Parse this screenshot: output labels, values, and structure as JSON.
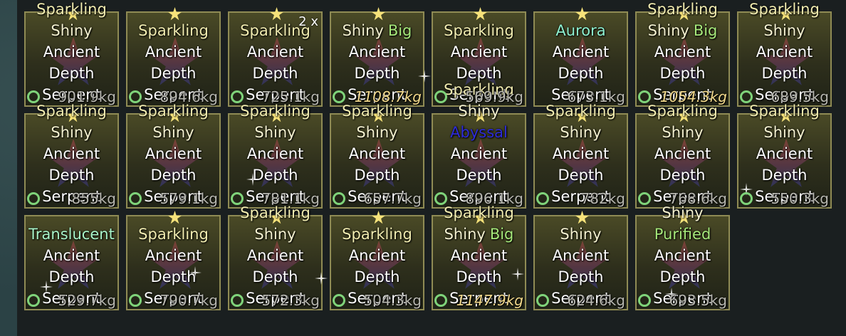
{
  "inventory": {
    "items": [
      {
        "lines": [
          [
            {
              "t": "Sparkling",
              "c": "sparkling"
            }
          ],
          [
            {
              "t": "Shiny",
              "c": "shiny"
            }
          ],
          [
            {
              "t": "Ancient"
            }
          ],
          [
            {
              "t": "Depth"
            }
          ],
          [
            {
              "t": "Serpent"
            }
          ]
        ],
        "weight": "901.9kg",
        "gold": false,
        "star": true
      },
      {
        "lines": [
          [
            {
              "t": "Sparkling",
              "c": "sparkling"
            }
          ],
          [
            {
              "t": "Ancient"
            }
          ],
          [
            {
              "t": "Depth"
            }
          ],
          [
            {
              "t": "Serpent"
            }
          ]
        ],
        "weight": "894.6kg",
        "gold": false,
        "star": true
      },
      {
        "lines": [
          [
            {
              "t": "Sparkling",
              "c": "sparkling"
            }
          ],
          [
            {
              "t": "Ancient"
            }
          ],
          [
            {
              "t": "Depth"
            }
          ],
          [
            {
              "t": "Serpent"
            }
          ]
        ],
        "weight": "725.1kg",
        "gold": false,
        "star": true,
        "count": "2 x"
      },
      {
        "lines": [
          [
            {
              "t": "Shiny",
              "c": "shiny"
            },
            {
              "t": "Big",
              "c": "big"
            }
          ],
          [
            {
              "t": "Ancient"
            }
          ],
          [
            {
              "t": "Depth"
            }
          ],
          [
            {
              "t": "Serpent"
            }
          ]
        ],
        "weight": "1108.7kg",
        "gold": true,
        "star": true
      },
      {
        "lines": [
          [
            {
              "t": "Sparkling",
              "c": "sparkling"
            }
          ],
          [
            {
              "t": "Ancient"
            }
          ],
          [
            {
              "t": "Depth"
            }
          ],
          [
            {
              "t": "Serpent"
            }
          ]
        ],
        "weight": "569.9kg",
        "gold": false,
        "star": true
      },
      {
        "lines": [
          [
            {
              "t": "Aurora",
              "c": "aurora"
            }
          ],
          [
            {
              "t": "Ancient"
            }
          ],
          [
            {
              "t": "Depth"
            }
          ],
          [
            {
              "t": "Serpent"
            }
          ]
        ],
        "weight": "673.1kg",
        "gold": false,
        "star": true,
        "nofav": true
      },
      {
        "lines": [
          [
            {
              "t": "Sparkling",
              "c": "sparkling"
            }
          ],
          [
            {
              "t": "Shiny",
              "c": "shiny"
            },
            {
              "t": "Big",
              "c": "big"
            }
          ],
          [
            {
              "t": "Ancient"
            }
          ],
          [
            {
              "t": "Depth"
            }
          ],
          [
            {
              "t": "Serpent"
            }
          ]
        ],
        "weight": "1054.3kg",
        "gold": true,
        "star": true
      },
      {
        "lines": [
          [
            {
              "t": "Sparkling",
              "c": "sparkling"
            }
          ],
          [
            {
              "t": "Shiny",
              "c": "shiny"
            }
          ],
          [
            {
              "t": "Ancient"
            }
          ],
          [
            {
              "t": "Depth"
            }
          ],
          [
            {
              "t": "Serpent"
            }
          ]
        ],
        "weight": "689.5kg",
        "gold": false,
        "star": true
      },
      {
        "lines": [
          [
            {
              "t": "Sparkling",
              "c": "sparkling"
            }
          ],
          [
            {
              "t": "Shiny",
              "c": "shiny"
            }
          ],
          [
            {
              "t": "Ancient"
            }
          ],
          [
            {
              "t": "Depth"
            }
          ],
          [
            {
              "t": "Serpent"
            }
          ]
        ],
        "weight": "855kg",
        "gold": false,
        "star": true
      },
      {
        "lines": [
          [
            {
              "t": "Sparkling",
              "c": "sparkling"
            }
          ],
          [
            {
              "t": "Shiny",
              "c": "shiny"
            }
          ],
          [
            {
              "t": "Ancient"
            }
          ],
          [
            {
              "t": "Depth"
            }
          ],
          [
            {
              "t": "Serpent"
            }
          ]
        ],
        "weight": "579.1kg",
        "gold": false,
        "star": true
      },
      {
        "lines": [
          [
            {
              "t": "Sparkling",
              "c": "sparkling"
            }
          ],
          [
            {
              "t": "Shiny",
              "c": "shiny"
            }
          ],
          [
            {
              "t": "Ancient"
            }
          ],
          [
            {
              "t": "Depth"
            }
          ],
          [
            {
              "t": "Serpent"
            }
          ]
        ],
        "weight": "781.1kg",
        "gold": false,
        "star": true
      },
      {
        "lines": [
          [
            {
              "t": "Sparkling",
              "c": "sparkling"
            }
          ],
          [
            {
              "t": "Shiny",
              "c": "shiny"
            }
          ],
          [
            {
              "t": "Ancient"
            }
          ],
          [
            {
              "t": "Depth"
            }
          ],
          [
            {
              "t": "Serpent"
            }
          ]
        ],
        "weight": "657.7kg",
        "gold": false,
        "star": true
      },
      {
        "lines": [
          [
            {
              "t": "Sparkling",
              "c": "sparkling"
            }
          ],
          [
            {
              "t": "Shiny",
              "c": "shiny"
            }
          ],
          [
            {
              "t": "Abyssal",
              "c": "abyssal"
            }
          ],
          [
            {
              "t": "Ancient"
            }
          ],
          [
            {
              "t": "Depth"
            }
          ],
          [
            {
              "t": "Serpent"
            }
          ]
        ],
        "weight": "896.1kg",
        "gold": false,
        "star": true
      },
      {
        "lines": [
          [
            {
              "t": "Sparkling",
              "c": "sparkling"
            }
          ],
          [
            {
              "t": "Shiny",
              "c": "shiny"
            }
          ],
          [
            {
              "t": "Ancient"
            }
          ],
          [
            {
              "t": "Depth"
            }
          ],
          [
            {
              "t": "Serpent"
            }
          ]
        ],
        "weight": "782kg",
        "gold": false,
        "star": true
      },
      {
        "lines": [
          [
            {
              "t": "Sparkling",
              "c": "sparkling"
            }
          ],
          [
            {
              "t": "Shiny",
              "c": "shiny"
            }
          ],
          [
            {
              "t": "Ancient"
            }
          ],
          [
            {
              "t": "Depth"
            }
          ],
          [
            {
              "t": "Serpent"
            }
          ]
        ],
        "weight": "768.6kg",
        "gold": false,
        "star": true
      },
      {
        "lines": [
          [
            {
              "t": "Sparkling",
              "c": "sparkling"
            }
          ],
          [
            {
              "t": "Shiny",
              "c": "shiny"
            }
          ],
          [
            {
              "t": "Ancient"
            }
          ],
          [
            {
              "t": "Depth"
            }
          ],
          [
            {
              "t": "Serpent"
            }
          ]
        ],
        "weight": "550.3kg",
        "gold": false,
        "star": true
      },
      {
        "lines": [
          [
            {
              "t": "Translucent",
              "c": "translucent"
            }
          ],
          [
            {
              "t": "Ancient"
            }
          ],
          [
            {
              "t": "Depth"
            }
          ],
          [
            {
              "t": "Serpent"
            }
          ]
        ],
        "weight": "529.7kg",
        "gold": false,
        "star": false
      },
      {
        "lines": [
          [
            {
              "t": "Sparkling",
              "c": "sparkling"
            }
          ],
          [
            {
              "t": "Ancient"
            }
          ],
          [
            {
              "t": "Depth"
            }
          ],
          [
            {
              "t": "Serpent"
            }
          ]
        ],
        "weight": "790.7kg",
        "gold": false,
        "star": true
      },
      {
        "lines": [
          [
            {
              "t": "Sparkling",
              "c": "sparkling"
            }
          ],
          [
            {
              "t": "Shiny",
              "c": "shiny"
            }
          ],
          [
            {
              "t": "Ancient"
            }
          ],
          [
            {
              "t": "Depth"
            }
          ],
          [
            {
              "t": "Serpent"
            }
          ]
        ],
        "weight": "572.3kg",
        "gold": false,
        "star": true
      },
      {
        "lines": [
          [
            {
              "t": "Sparkling",
              "c": "sparkling"
            }
          ],
          [
            {
              "t": "Ancient"
            }
          ],
          [
            {
              "t": "Depth"
            }
          ],
          [
            {
              "t": "Serpent"
            }
          ]
        ],
        "weight": "504.3kg",
        "gold": false,
        "star": true
      },
      {
        "lines": [
          [
            {
              "t": "Sparkling",
              "c": "sparkling"
            }
          ],
          [
            {
              "t": "Shiny",
              "c": "shiny"
            },
            {
              "t": "Big",
              "c": "big"
            }
          ],
          [
            {
              "t": "Ancient"
            }
          ],
          [
            {
              "t": "Depth"
            }
          ],
          [
            {
              "t": "Serpent"
            }
          ]
        ],
        "weight": "1147.9kg",
        "gold": true,
        "star": true
      },
      {
        "lines": [
          [
            {
              "t": "Shiny",
              "c": "shiny"
            }
          ],
          [
            {
              "t": "Ancient"
            }
          ],
          [
            {
              "t": "Depth"
            }
          ],
          [
            {
              "t": "Serpent"
            }
          ]
        ],
        "weight": "624.6kg",
        "gold": false,
        "star": true
      },
      {
        "lines": [
          [
            {
              "t": "Shiny",
              "c": "shiny"
            }
          ],
          [
            {
              "t": "Purified",
              "c": "purified"
            }
          ],
          [
            {
              "t": "Ancient"
            }
          ],
          [
            {
              "t": "Depth"
            }
          ],
          [
            {
              "t": "Serpent"
            }
          ]
        ],
        "weight": "693.5kg",
        "gold": false,
        "star": true
      }
    ]
  },
  "colors": {
    "tile_border": "#8f8b54",
    "favorite_ring": "#7fd37a",
    "weight_gold": "#f2d98b",
    "weight_normal": "#b8b8b0",
    "star_yellow": "#f6e27a"
  },
  "icons": {
    "top": "star-icon",
    "background": "fish-star-silhouette-icon",
    "favorite": "favorite-ring-icon",
    "sparkle": "sparkle-icon"
  }
}
